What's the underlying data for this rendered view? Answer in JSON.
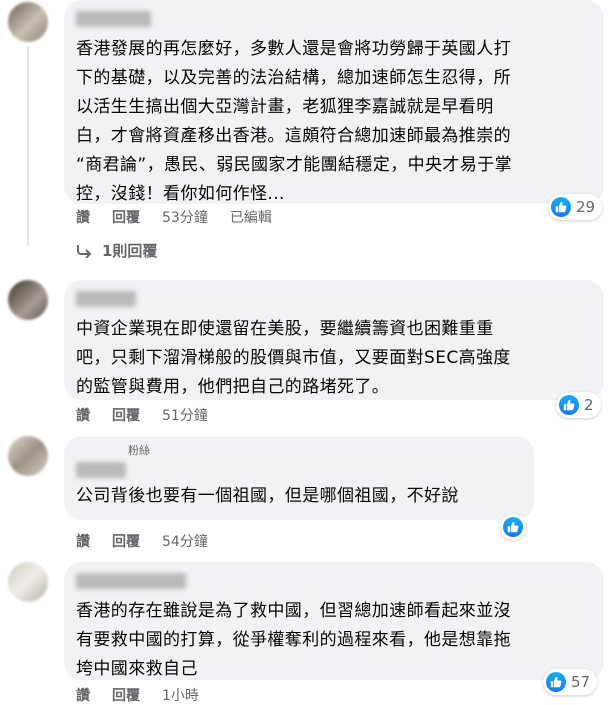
{
  "comments": [
    {
      "text": "香港發展的再怎麼好，多數人還是會將功勞歸于英國人打\n下的基礎，以及完善的法治結構，總加速師怎生忍得，所\n以活生生搞出個大亞灣計畫，老狐狸李嘉誠就是早看明\n白，才會將資產移出香港。這頗符合總加速師最為推崇的\n“商君論”，愚民、弱民國家才能團結穩定，中央才易于掌\n控，沒錢！看你如何作怪...",
      "like_label": "讚",
      "reply_label": "回覆",
      "time": "53分鐘",
      "edited": "已編輯",
      "reaction_count": "29"
    },
    {
      "text": "中資企業現在即使還留在美股，要繼續籌資也困難重重\n吧，只剩下溜滑梯般的股價與市值，又要面對SEC高強度\n的監管與費用，他們把自己的路堵死了。",
      "like_label": "讚",
      "reply_label": "回覆",
      "time": "51分鐘",
      "reaction_count": "2"
    },
    {
      "author_note": "粉絲",
      "text": "公司背後也要有一個祖國，但是哪個祖國，不好說",
      "like_label": "讚",
      "reply_label": "回覆",
      "time": "54分鐘"
    },
    {
      "text": "香港的存在雖說是為了救中國，但習總加速師看起來並沒\n有要救中國的打算，從爭權奪利的過程來看，他是想靠拖\n垮中國來救自己",
      "like_label": "讚",
      "reply_label": "回覆",
      "time": "1小時",
      "reaction_count": "57"
    }
  ],
  "replies_link": "1則回覆",
  "colors": {
    "accent": "#1877f2",
    "bubble": "#f0f2f5",
    "meta": "#65676b"
  },
  "icons": {
    "like": "thumbs-up-icon",
    "reply_arrow": "reply-arrow-icon"
  }
}
